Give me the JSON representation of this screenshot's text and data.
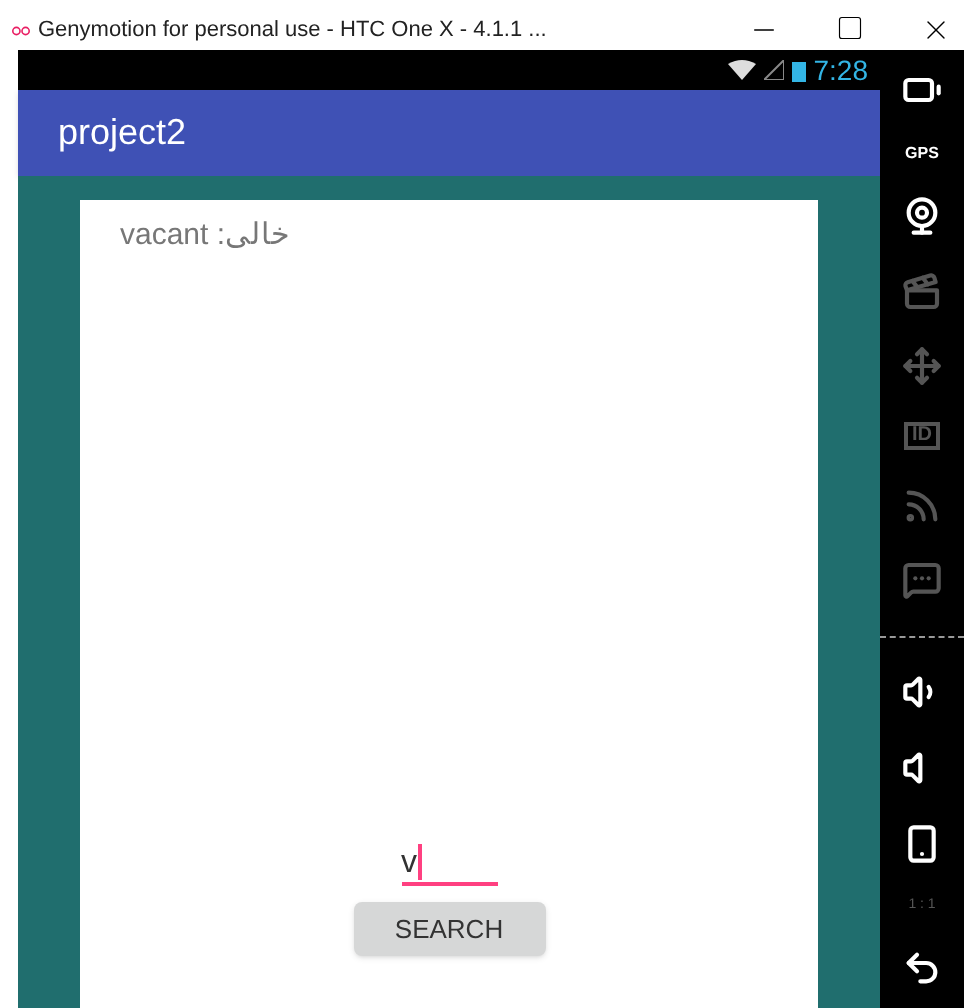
{
  "window": {
    "title": "Genymotion for personal use - HTC One X - 4.1.1 ..."
  },
  "status_bar": {
    "time": "7:28"
  },
  "app_bar": {
    "title": "project2"
  },
  "card": {
    "label": "خالی: vacant",
    "input": {
      "value": "v",
      "focused": true
    },
    "button": "SEARCH"
  },
  "sidebar": {
    "items": [
      {
        "kind": "battery",
        "disabled": false
      },
      {
        "kind": "gps",
        "label": "GPS",
        "disabled": false
      },
      {
        "kind": "camera",
        "disabled": false
      },
      {
        "kind": "media",
        "disabled": true
      },
      {
        "kind": "dpad",
        "disabled": true
      },
      {
        "kind": "id",
        "label": "ID",
        "disabled": true
      },
      {
        "kind": "cast",
        "disabled": true
      },
      {
        "kind": "sms",
        "disabled": true
      },
      {
        "kind": "separator"
      },
      {
        "kind": "volume-up",
        "disabled": false
      },
      {
        "kind": "volume-down",
        "disabled": false
      },
      {
        "kind": "rotate",
        "disabled": false
      },
      {
        "kind": "pixel",
        "label": "1 : 1",
        "disabled": true
      },
      {
        "kind": "back",
        "disabled": false
      }
    ]
  }
}
